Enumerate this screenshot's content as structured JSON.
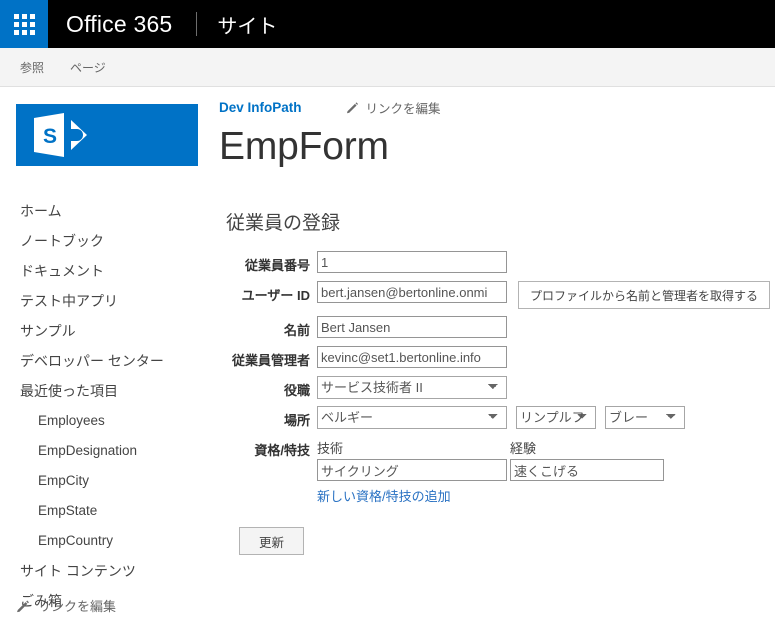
{
  "suite_bar": {
    "app_launcher_label": "app-launcher",
    "brand": "Office 365",
    "site_label": "サイト",
    "accent_color": "#0072c6",
    "background_color": "#000000"
  },
  "ribbon": {
    "tabs": [
      {
        "label": "参照"
      },
      {
        "label": "ページ"
      }
    ]
  },
  "sidebar": {
    "logo_alt": "SharePoint",
    "items": [
      {
        "label": "ホーム",
        "sub": false
      },
      {
        "label": "ノートブック",
        "sub": false
      },
      {
        "label": "ドキュメント",
        "sub": false
      },
      {
        "label": "テスト中アプリ",
        "sub": false
      },
      {
        "label": "サンプル",
        "sub": false
      },
      {
        "label": "デベロッパー センター",
        "sub": false
      },
      {
        "label": "最近使った項目",
        "sub": false
      },
      {
        "label": "Employees",
        "sub": true
      },
      {
        "label": "EmpDesignation",
        "sub": true
      },
      {
        "label": "EmpCity",
        "sub": true
      },
      {
        "label": "EmpState",
        "sub": true
      },
      {
        "label": "EmpCountry",
        "sub": true
      },
      {
        "label": "サイト コンテンツ",
        "sub": false
      },
      {
        "label": "ごみ箱",
        "sub": false
      }
    ],
    "edit_links_label": "リンクを編集"
  },
  "header": {
    "breadcrumb": "Dev InfoPath",
    "edit_links_label": "リンクを編集",
    "title": "EmpForm",
    "breadcrumb_color": "#0072c6"
  },
  "form": {
    "heading": "従業員の登録",
    "fields": {
      "employee_number": {
        "label": "従業員番号",
        "value": "1",
        "placeholder": ""
      },
      "user_id": {
        "label": "ユーザー ID",
        "value": "bert.jansen@bertonline.onmi",
        "placeholder": ""
      },
      "name": {
        "label": "名前",
        "value": "Bert Jansen",
        "placeholder": ""
      },
      "manager": {
        "label": "従業員管理者",
        "value": "kevinc@set1.bertonline.info",
        "placeholder": ""
      },
      "title": {
        "label": "役職",
        "value": "サービス技術者 II",
        "options": [
          "サービス技術者 II"
        ]
      },
      "location": {
        "label": "場所",
        "country_value": "ベルギー",
        "country_options": [
          "ベルギー"
        ],
        "state_value": "リンプルフ",
        "state_options": [
          "リンプルフ"
        ],
        "city_value": "ブレー",
        "city_options": [
          "ブレー"
        ]
      },
      "skills": {
        "label": "資格/特技",
        "col_skill_header": "技術",
        "col_experience_header": "経験",
        "skill_value": "サイクリング",
        "experience_value": "速くこげる",
        "add_link": "新しい資格/特技の追加"
      }
    },
    "profile_button": "プロファイルから名前と管理者を取得する",
    "update_button": "更新",
    "link_color": "#2a72c3"
  }
}
